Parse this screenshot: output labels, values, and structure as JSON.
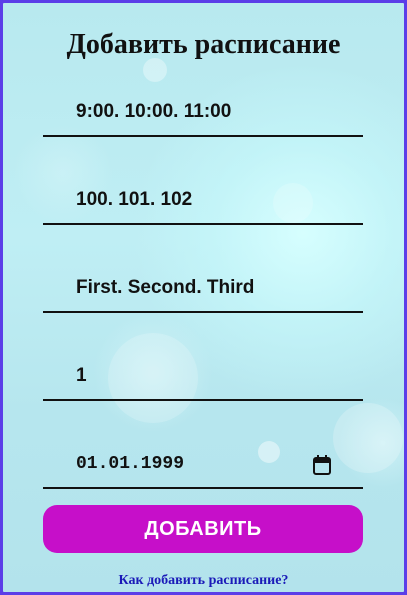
{
  "form": {
    "title": "Добавить расписание",
    "fields": [
      {
        "value": "9:00. 10:00. 11:00"
      },
      {
        "value": "100. 101. 102"
      },
      {
        "value": "First. Second. Third"
      },
      {
        "value": "1"
      },
      {
        "value": "01.01.1999"
      }
    ],
    "date_icon": "calendar-icon",
    "submit_label": "ДОБАВИТЬ",
    "help_link": "Как добавить расписание?"
  },
  "colors": {
    "accent": "#c60fc9",
    "border": "#5b3ee8",
    "link": "#1a1ab8"
  }
}
